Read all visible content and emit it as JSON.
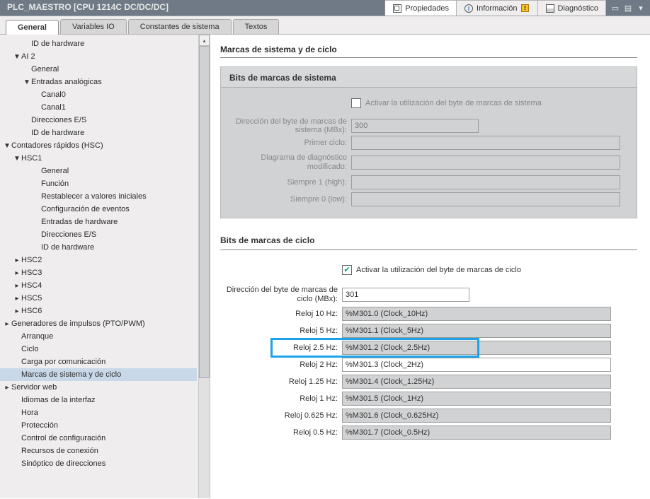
{
  "titlebar": {
    "title": "PLC_MAESTRO [CPU 1214C DC/DC/DC]"
  },
  "inspector_tabs": {
    "props": "Propiedades",
    "info": "Información",
    "diag": "Diagnóstico"
  },
  "main_tabs": {
    "general": "General",
    "vars": "Variables IO",
    "consts": "Constantes de sistema",
    "texts": "Textos"
  },
  "tree": {
    "n0": "ID de hardware",
    "n1": "AI 2",
    "n2": "General",
    "n3": "Entradas analógicas",
    "n4": "Canal0",
    "n5": "Canal1",
    "n6": "Direcciones E/S",
    "n7": "ID de hardware",
    "n8": "Contadores rápidos (HSC)",
    "n9": "HSC1",
    "n10": "General",
    "n11": "Función",
    "n12": "Restablecer a valores iniciales",
    "n13": "Configuración de eventos",
    "n14": "Entradas de hardware",
    "n15": "Direcciones E/S",
    "n16": "ID de hardware",
    "n17": "HSC2",
    "n18": "HSC3",
    "n19": "HSC4",
    "n20": "HSC5",
    "n21": "HSC6",
    "n22": "Generadores de impulsos (PTO/PWM)",
    "n23": "Arranque",
    "n24": "Ciclo",
    "n25": "Carga por comunicación",
    "n26": "Marcas de sistema y de ciclo",
    "n27": "Servidor web",
    "n28": "Idiomas de la interfaz",
    "n29": "Hora",
    "n30": "Protección",
    "n31": "Control de configuración",
    "n32": "Recursos de conexión",
    "n33": "Sinóptico de direcciones"
  },
  "content": {
    "title": "Marcas de sistema y de ciclo",
    "sys": {
      "panel_title": "Bits de marcas de sistema",
      "chk_label": "Activar la utilización del byte de marcas de sistema",
      "addr_label": "Dirección del byte de marcas de sistema (MBx):",
      "addr_val": "300",
      "first_label": "Primer ciclo:",
      "diag_label": "Diagrama de diagnóstico modificado:",
      "always1_label": "Siempre 1 (high):",
      "always0_label": "Siempre 0 (low):"
    },
    "cyc": {
      "panel_title": "Bits de marcas de ciclo",
      "chk_label": "Activar la utilización del byte de marcas de ciclo",
      "addr_label": "Dirección del byte de marcas de ciclo (MBx):",
      "addr_val": "301",
      "r10_label": "Reloj 10 Hz:",
      "r10_val": "%M301.0 (Clock_10Hz)",
      "r5_label": "Reloj 5 Hz:",
      "r5_val": "%M301.1 (Clock_5Hz)",
      "r25_label": "Reloj 2.5 Hz:",
      "r25_val": "%M301.2 (Clock_2.5Hz)",
      "r2_label": "Reloj 2 Hz:",
      "r2_val": "%M301.3 (Clock_2Hz)",
      "r125_label": "Reloj 1.25 Hz:",
      "r125_val": "%M301.4 (Clock_1.25Hz)",
      "r1_label": "Reloj 1 Hz:",
      "r1_val": "%M301.5 (Clock_1Hz)",
      "r0625_label": "Reloj 0.625 Hz:",
      "r0625_val": "%M301.6 (Clock_0.625Hz)",
      "r05_label": "Reloj 0.5 Hz:",
      "r05_val": "%M301.7 (Clock_0.5Hz)"
    }
  }
}
